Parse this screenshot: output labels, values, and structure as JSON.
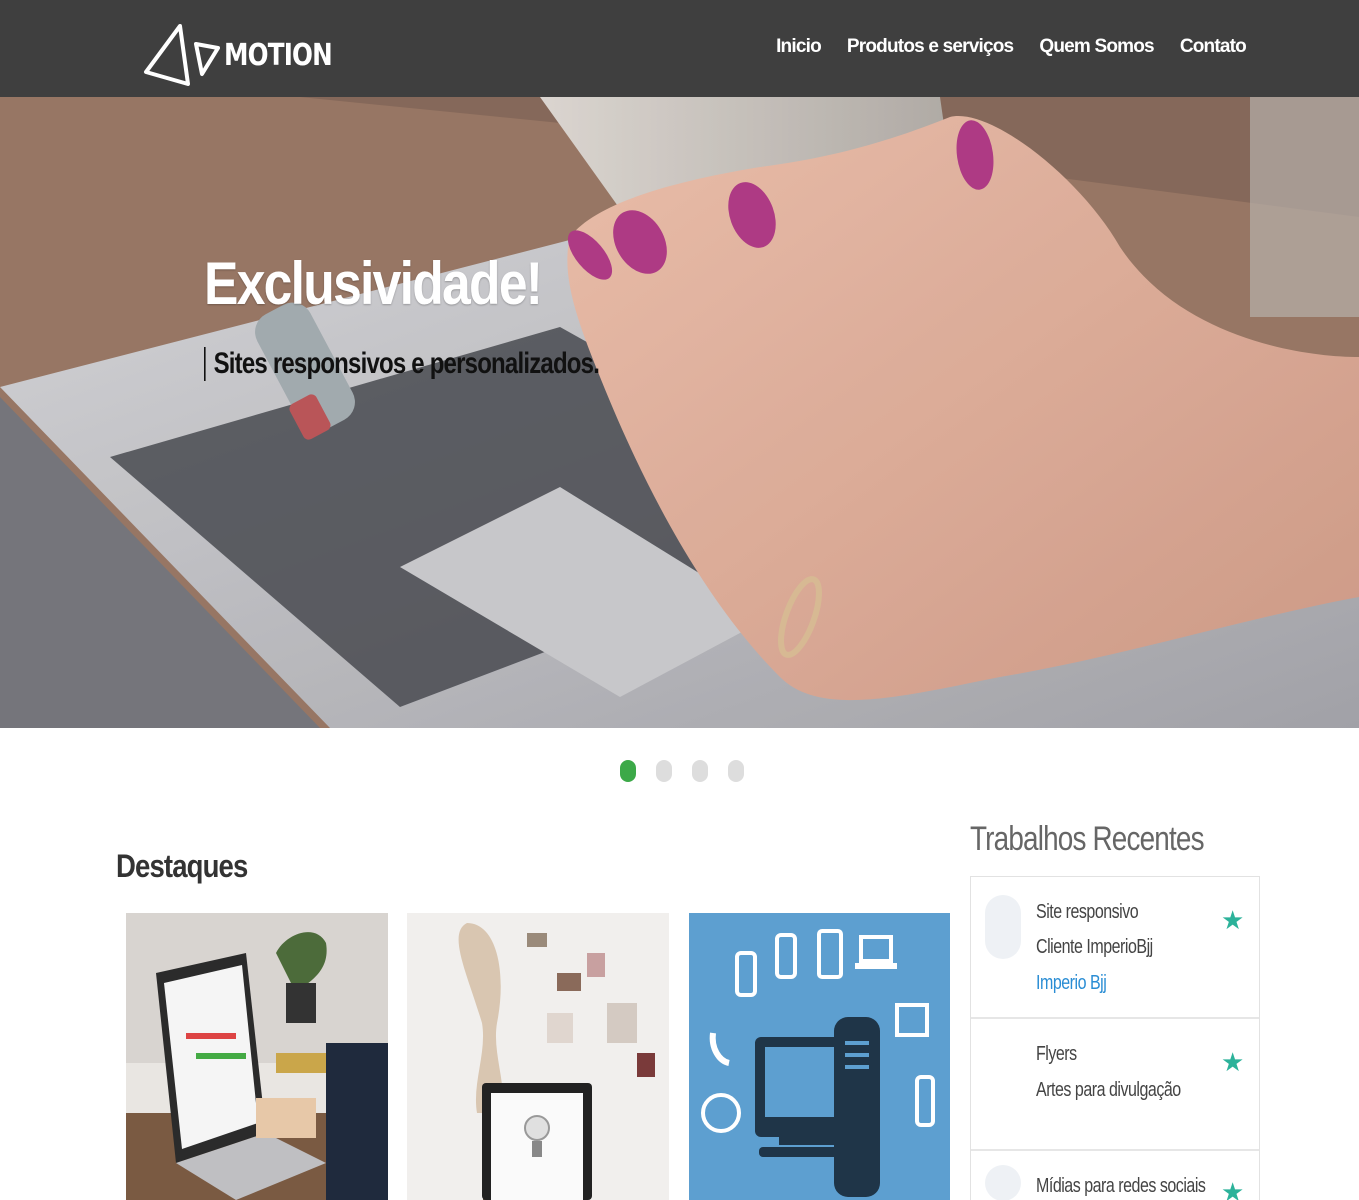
{
  "brand": {
    "name": "MOTION"
  },
  "nav": {
    "items": [
      "Inicio",
      "Produtos e serviços",
      "Quem Somos",
      "Contato"
    ]
  },
  "hero": {
    "title": "Exclusividade!",
    "subtitle": "Sites responsivos e personalizados.",
    "slide_count": 4,
    "active_slide": 1
  },
  "highlights": {
    "title": "Destaques"
  },
  "recent": {
    "title": "Trabalhos Recentes",
    "items": [
      {
        "line1": "Site responsivo",
        "line2": "Cliente ImperioBjj",
        "link": "Imperio Bjj"
      },
      {
        "line1": "Flyers",
        "line2": "Artes para divulgação"
      },
      {
        "line1": "Mídias para redes sociais"
      }
    ]
  },
  "colors": {
    "navbar": "#3f3f3f",
    "dot_active": "#3ca948",
    "dot_inactive": "#dddddd",
    "star": "#2cb29a",
    "link": "#2a8dd4"
  }
}
